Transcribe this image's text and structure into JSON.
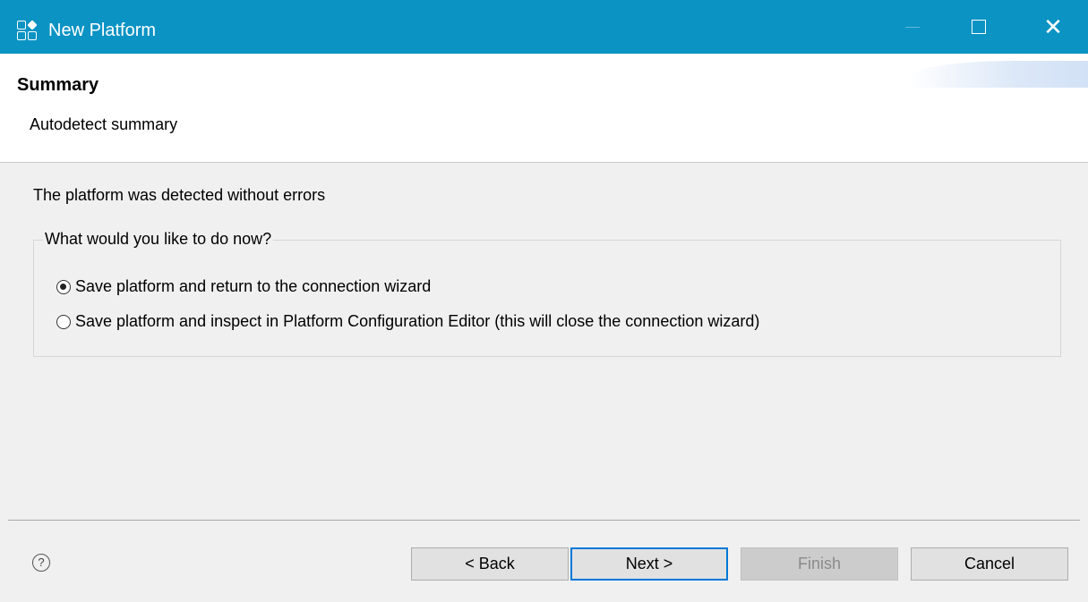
{
  "window": {
    "title": "New Platform"
  },
  "header": {
    "title": "Summary",
    "subtitle": "Autodetect summary"
  },
  "body": {
    "status_message": "The platform was detected without errors",
    "group_label": "What would you like to do now?",
    "options": [
      {
        "label": "Save platform and return to the connection wizard",
        "selected": true
      },
      {
        "label": "Save platform and inspect in Platform Configuration Editor (this will close the connection wizard)",
        "selected": false
      }
    ]
  },
  "footer": {
    "help_glyph": "?",
    "back_label": "< Back",
    "next_label": "Next >",
    "finish_label": "Finish",
    "cancel_label": "Cancel"
  },
  "colors": {
    "titlebar": "#0b93c4",
    "default_button_border": "#0078d7"
  }
}
